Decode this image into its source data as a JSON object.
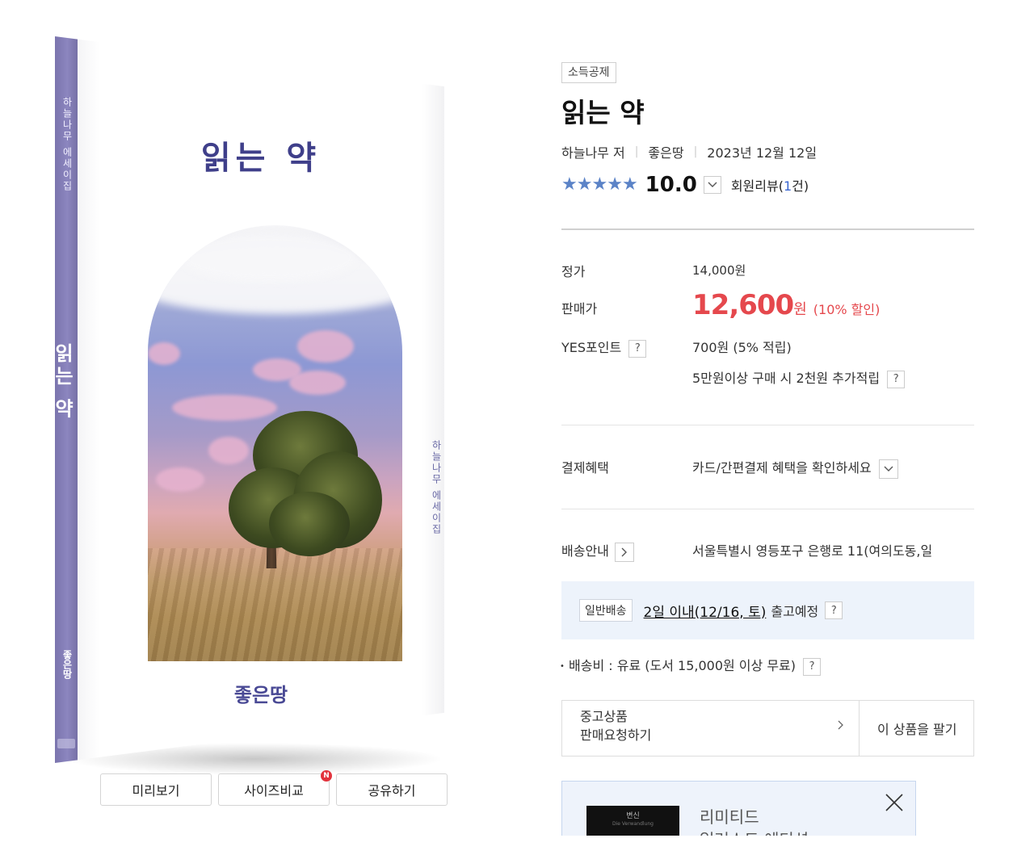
{
  "book": {
    "spine_top": "하늘나무 에세이집",
    "spine_title": "읽는 약",
    "spine_publisher": "좋은땅",
    "cover_title": "읽는 약",
    "cover_side_text": "하늘나무 에세이집",
    "cover_publisher": "좋은땅",
    "buttons": {
      "preview": "미리보기",
      "size_compare": "사이즈비교",
      "share": "공유하기",
      "new_badge": "N"
    }
  },
  "product": {
    "tag": "소득공제",
    "title": "읽는 약",
    "author": "하늘나무 저",
    "publisher": "좋은땅",
    "date": "2023년 12월 12일",
    "rating": "10.0",
    "review_label": "회원리뷰(",
    "review_count": "1",
    "review_suffix": "건)"
  },
  "price": {
    "list_label": "정가",
    "list_value": "14,000원",
    "sale_label": "판매가",
    "sale_value": "12,600",
    "sale_unit": "원",
    "discount": "(10% 할인)",
    "point_label": "YES포인트",
    "point_value": "700원 (5% 적립)",
    "extra_point": "5만원이상 구매 시 2천원 추가적립"
  },
  "payment": {
    "label": "결제혜택",
    "value": "카드/간편결제 혜택을 확인하세요"
  },
  "delivery": {
    "label": "배송안내",
    "address": "서울특별시 영등포구 은행로 11(여의도동,일",
    "ship_type": "일반배송",
    "ship_date": "2일 이내(12/16, 토)",
    "ship_after": "출고예정",
    "fee": "배송비 : 유료 (도서 15,000원 이상 무료)"
  },
  "used": {
    "left_line1": "중고상품",
    "left_line2": "판매요청하기",
    "right": "이 상품을 팔기"
  },
  "limited": {
    "line1": "리미티드",
    "line2": "일러스트 에디션",
    "thumb_title": "변신",
    "thumb_sub": "Die Verwandlung"
  },
  "colors": {
    "accent_price": "#e5484d",
    "star": "#5b83c7",
    "spine": "#8c86bf",
    "ship_bg": "#edf3fb"
  },
  "icons": [
    "star-icon",
    "chevron-down-icon",
    "question-icon",
    "chevron-right-icon",
    "close-icon"
  ]
}
